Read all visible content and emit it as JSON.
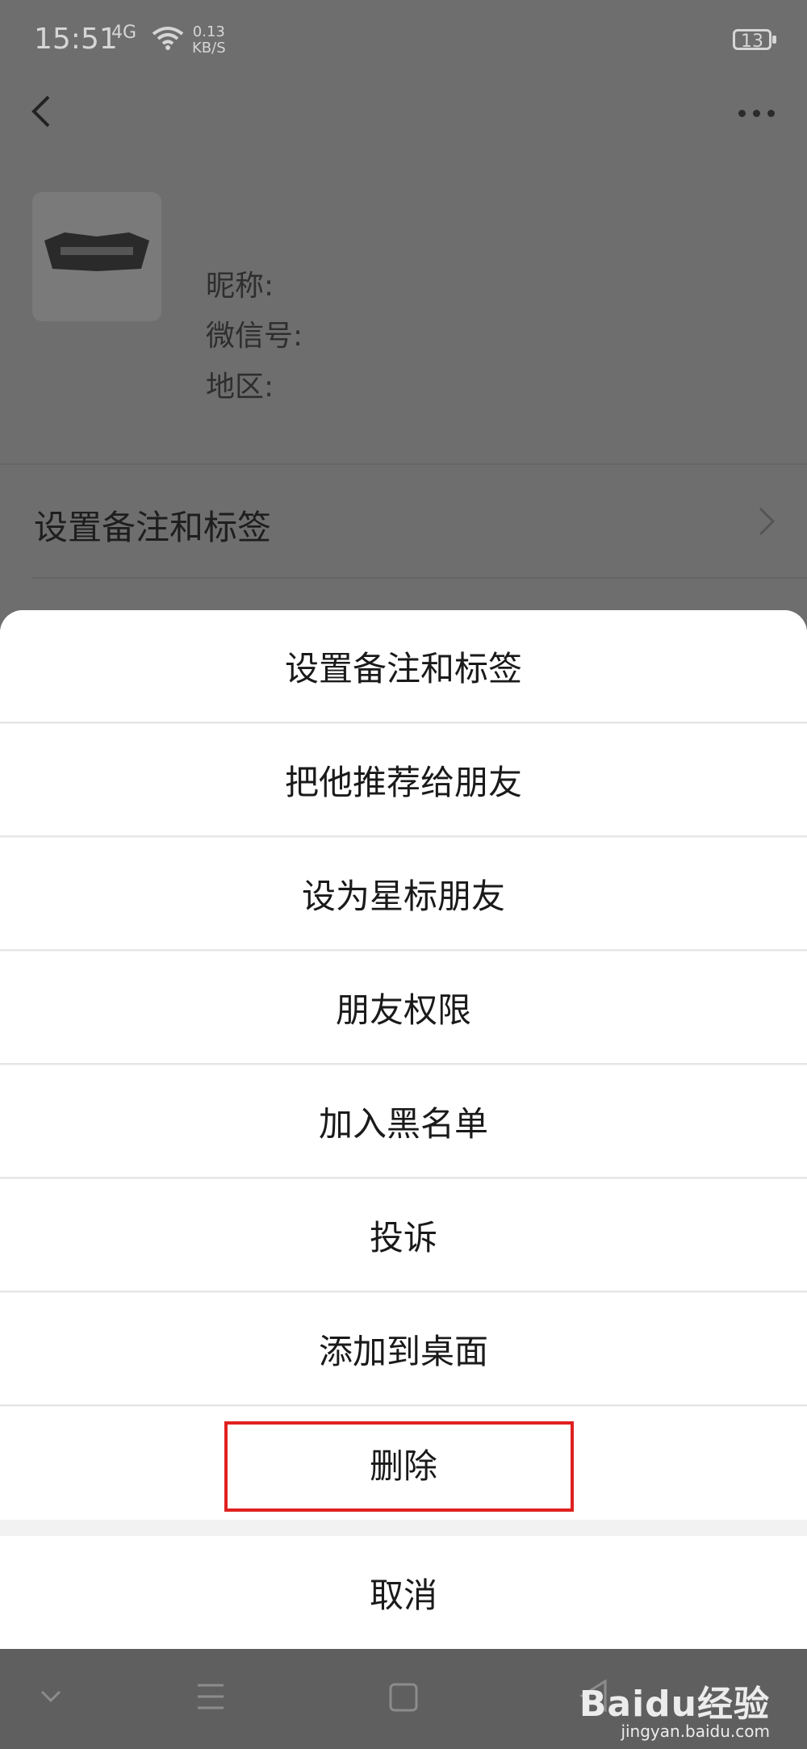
{
  "status_bar": {
    "time": "15:51",
    "signal": "4G",
    "net_speed": "0.13",
    "net_unit": "KB/S",
    "battery": "13"
  },
  "profile": {
    "nickname_label": "昵称:",
    "wechat_id_label": "微信号:",
    "region_label": "地区:"
  },
  "background_menu": {
    "remark_label": "设置备注和标签"
  },
  "sheet": {
    "items": [
      "设置备注和标签",
      "把他推荐给朋友",
      "设为星标朋友",
      "朋友权限",
      "加入黑名单",
      "投诉",
      "添加到桌面",
      "删除"
    ],
    "cancel": "取消"
  },
  "watermark": {
    "logo": "Baidu经验",
    "url": "jingyan.baidu.com"
  },
  "colors": {
    "highlight": "#e02020",
    "overlay": "#6e6e6e"
  }
}
